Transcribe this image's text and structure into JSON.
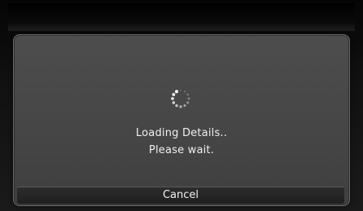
{
  "dialog": {
    "message_line1": "Loading Details..",
    "message_line2": "Please wait.",
    "cancel_label": "Cancel",
    "spinner_icon": "loading-spinner-icon"
  },
  "colors": {
    "background": "#0c0c0c",
    "dialog_bg": "#484848",
    "text": "#f0f0f0",
    "button_bg": "#262626"
  }
}
